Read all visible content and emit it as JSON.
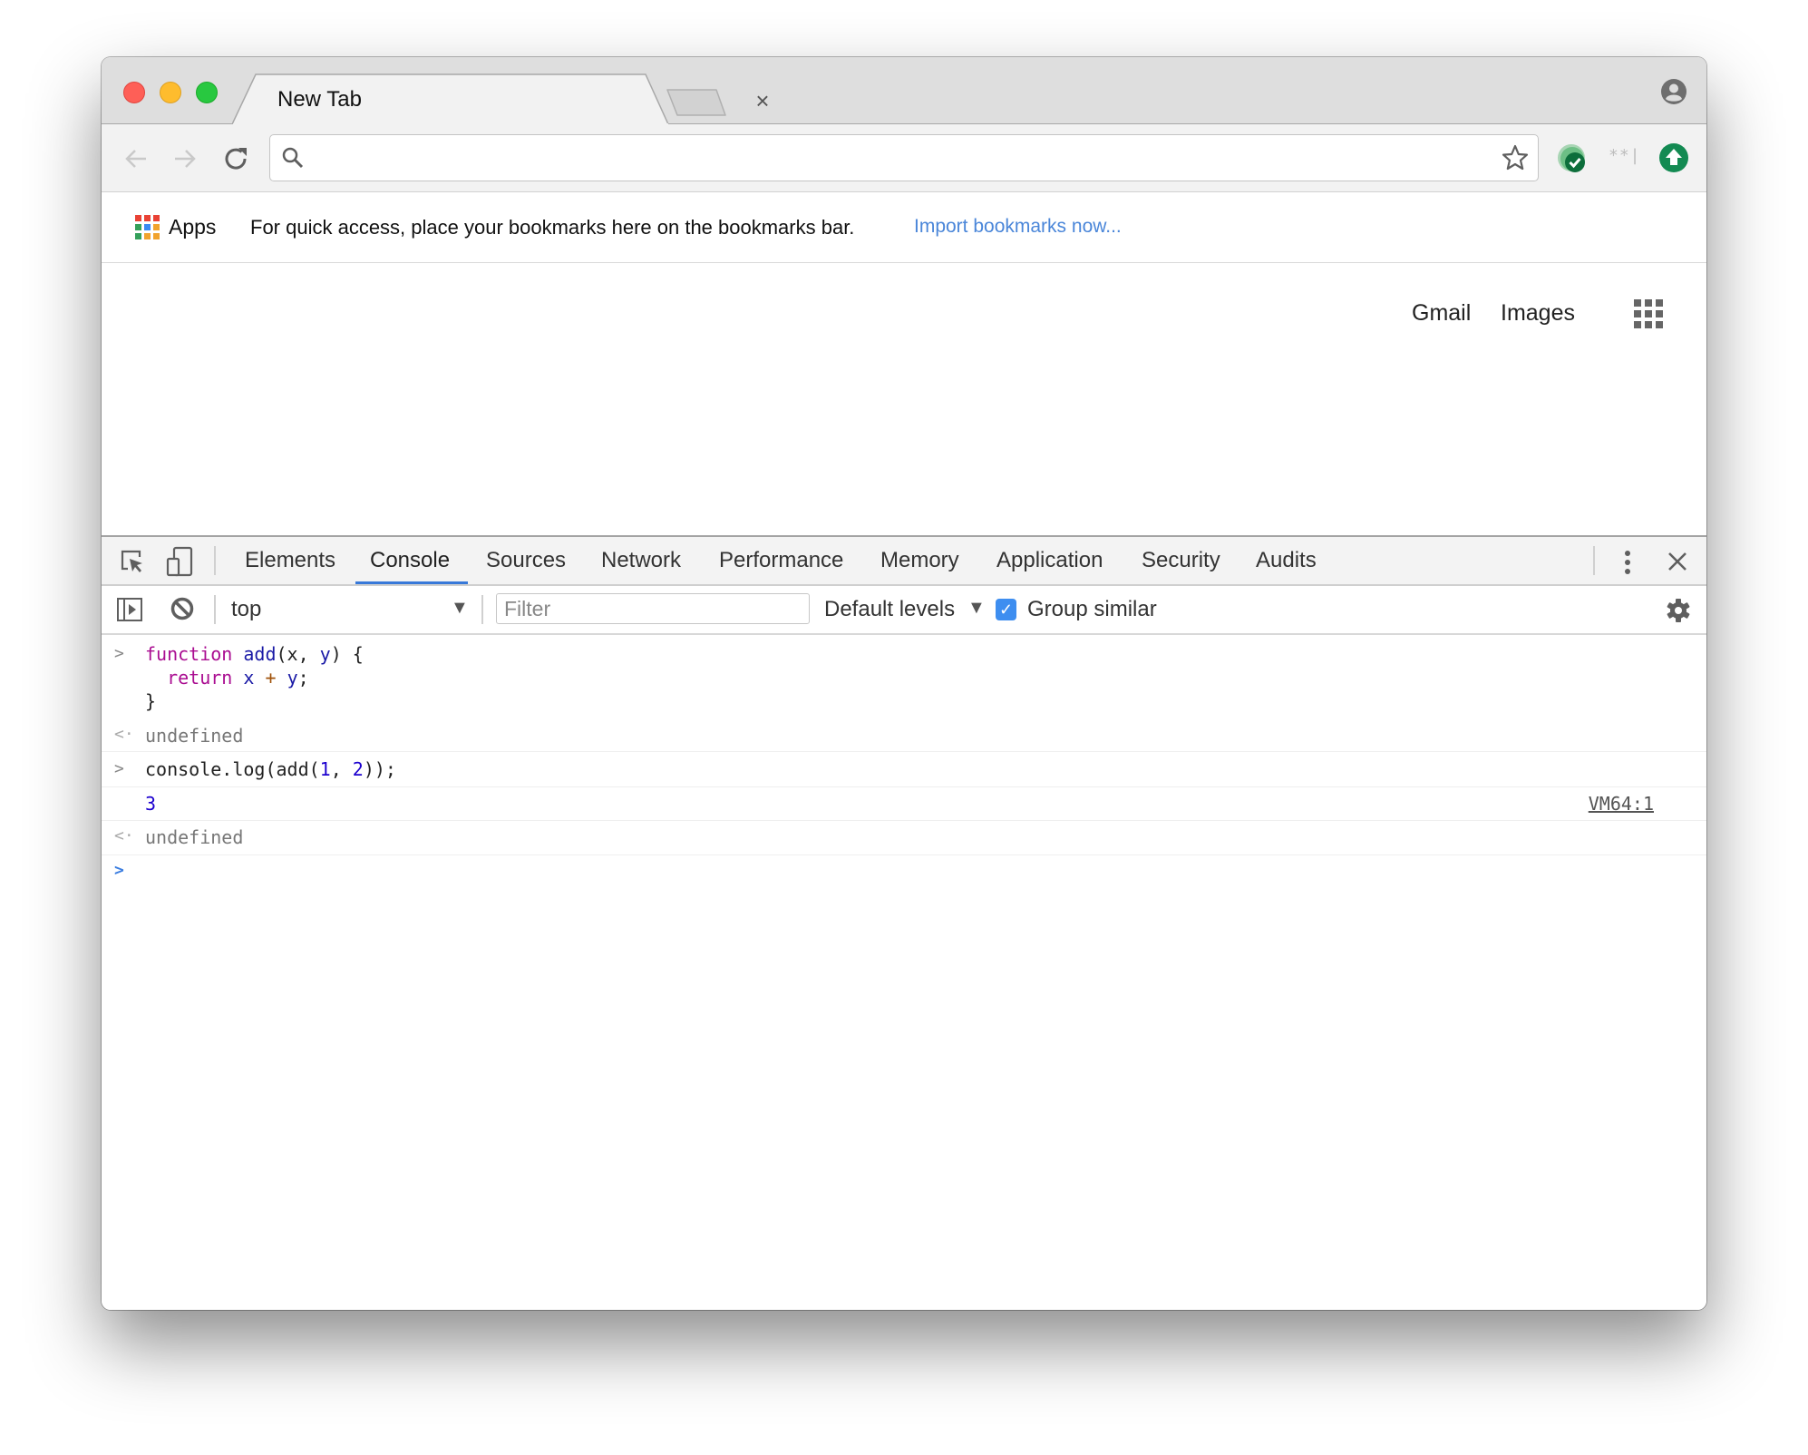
{
  "browser": {
    "tab": {
      "title": "New Tab",
      "close_glyph": "×"
    },
    "toolbar": {
      "omnibox_value": "",
      "omnibox_placeholder": ""
    },
    "extensions": [
      "green-check-extension",
      "password-extension",
      "update-extension"
    ],
    "bookmarks_bar": {
      "apps_label": "Apps",
      "hint": "For quick access, place your bookmarks here on the bookmarks bar.",
      "import_link": "Import bookmarks now..."
    },
    "colors": {
      "link": "#4a86d9",
      "accent": "#3879d9",
      "close": "#ff5f57",
      "minimize": "#febc2e",
      "maximize": "#28c840"
    }
  },
  "page": {
    "links": {
      "gmail": "Gmail",
      "images": "Images"
    }
  },
  "devtools": {
    "tabs": [
      {
        "label": "Elements"
      },
      {
        "label": "Console",
        "active": true
      },
      {
        "label": "Sources"
      },
      {
        "label": "Network"
      },
      {
        "label": "Performance"
      },
      {
        "label": "Memory"
      },
      {
        "label": "Application"
      },
      {
        "label": "Security"
      },
      {
        "label": "Audits"
      }
    ],
    "console_toolbar": {
      "context": "top",
      "filter_placeholder": "Filter",
      "filter_value": "",
      "levels": "Default levels",
      "group_similar_label": "Group similar",
      "group_similar_checked": true
    },
    "console": {
      "input1": {
        "l1_kw": "function",
        "l1_fn": "add",
        "l1_p1": "(x, ",
        "l1_y": "y",
        "l1_end": ") {",
        "l2_kw": "return",
        "l2_x": "x",
        "l2_op": "+",
        "l2_y": "y",
        "l2_end": ";",
        "l3": "}"
      },
      "result1": "undefined",
      "input2": {
        "a": "console.log(add(",
        "n1": "1",
        "b": ", ",
        "n2": "2",
        "c": "));"
      },
      "log_output": "3",
      "log_source": "VM64:1",
      "result2": "undefined"
    }
  }
}
